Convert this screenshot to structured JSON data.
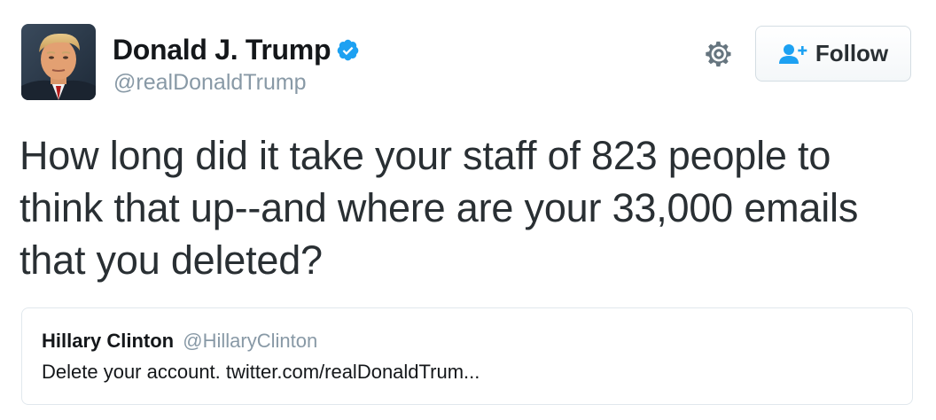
{
  "author": {
    "name": "Donald J. Trump",
    "handle": "@realDonaldTrump",
    "verified": true
  },
  "actions": {
    "follow_label": "Follow"
  },
  "tweet": {
    "text": "How long did it take your staff of 823 people to think that up--and where are your 33,000 emails that you deleted?"
  },
  "quoted_tweet": {
    "name": "Hillary Clinton",
    "handle": "@HillaryClinton",
    "text": "Delete your account. twitter.com/realDonaldTrum..."
  },
  "icons": {
    "verified": "verified-badge-icon",
    "settings": "gear-icon",
    "follow": "follow-user-icon"
  },
  "colors": {
    "verified_blue": "#1da1f2",
    "handle_gray": "#8899a6",
    "text": "#292f33",
    "follow_icon_blue": "#1da1f2"
  }
}
